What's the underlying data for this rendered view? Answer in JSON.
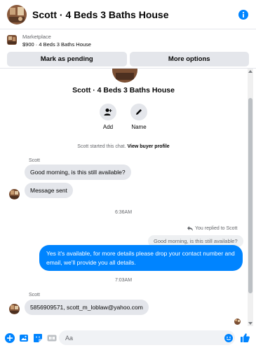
{
  "header": {
    "title": "Scott · 4 Beds 3 Baths House",
    "info_icon": "info-icon"
  },
  "marketplace": {
    "label": "Marketplace",
    "listing": "$900 · 4 Beds 3 Baths House",
    "buttons": {
      "pending": "Mark as pending",
      "more": "More options"
    }
  },
  "profile": {
    "title": "Scott · 4 Beds 3 Baths House",
    "actions": [
      {
        "label": "Add",
        "icon": "add-person-icon"
      },
      {
        "label": "Name",
        "icon": "pencil-icon"
      }
    ]
  },
  "conversation": {
    "started_prefix": "Scott started this chat.",
    "started_link": "View buyer profile",
    "sender_1": "Scott",
    "msg_1": "Good morning, is this still available?",
    "msg_2": "Message sent",
    "time_1": "6:36AM",
    "replied_label": "You replied to Scott",
    "quoted": "Good morning, is this still available?",
    "reply": "Yes it's available, for more details please drop your contact number and email, we'll provide you all details.",
    "time_2": "7:03AM",
    "sender_2": "Scott",
    "msg_3": "5856909571, scott_m_loblaw@yahoo.com"
  },
  "composer": {
    "placeholder": "Aa",
    "icons": [
      "plus-icon",
      "image-icon",
      "sticker-icon",
      "gif-icon",
      "emoji-icon",
      "thumbs-up-icon"
    ]
  },
  "colors": {
    "accent": "#0084ff",
    "bubble_in": "#e4e6eb",
    "muted": "#65676b"
  }
}
